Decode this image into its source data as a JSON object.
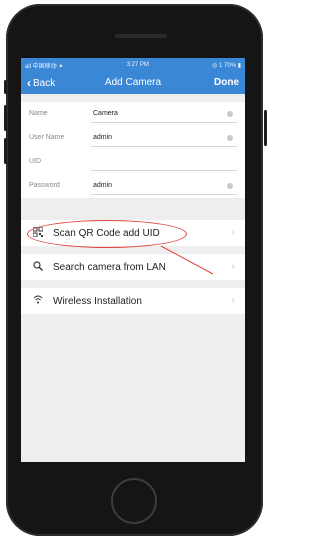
{
  "status": {
    "left": "all 中国移动 ✦",
    "time": "3:27 PM",
    "right": "◎ 1 70% ▮"
  },
  "nav": {
    "back_label": "Back",
    "title": "Add Camera",
    "done_label": "Done"
  },
  "form": {
    "fields": [
      {
        "label": "Name",
        "value": "Camera"
      },
      {
        "label": "User Name",
        "value": "admin"
      },
      {
        "label": "UID",
        "value": ""
      },
      {
        "label": "Password",
        "value": "admin"
      }
    ]
  },
  "menu": {
    "items": [
      {
        "label": "Scan QR Code add UID",
        "icon": "qr-code-icon"
      },
      {
        "label": "Search camera from LAN",
        "icon": "search-icon"
      },
      {
        "label": "Wireless Installation",
        "icon": "wifi-icon"
      }
    ]
  },
  "colors": {
    "nav_bg": "#3a87d6",
    "annotation": "#e0443e"
  }
}
